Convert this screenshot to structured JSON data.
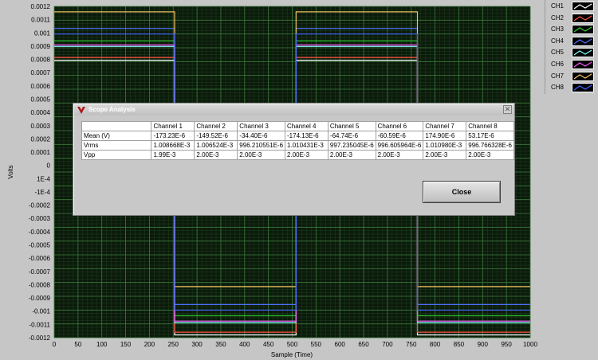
{
  "chart_data": {
    "type": "line",
    "xlabel": "Sample (Time)",
    "ylabel": "Volts",
    "xlim": [
      0,
      1000
    ],
    "ylim": [
      -0.0012,
      0.0012
    ],
    "xticks": [
      0,
      50,
      100,
      150,
      200,
      250,
      300,
      350,
      400,
      450,
      500,
      550,
      600,
      650,
      700,
      750,
      800,
      850,
      900,
      950,
      1000
    ],
    "xtick_labels": [
      "0",
      "50",
      "100",
      "150",
      "200",
      "250",
      "300",
      "350",
      "400",
      "450",
      "500",
      "550",
      "600",
      "650",
      "700",
      "750",
      "800",
      "850",
      "900",
      "950",
      "1000"
    ],
    "yticks": [
      0.0012,
      0.0011,
      0.001,
      0.0009,
      0.0008,
      0.0007,
      0.0006,
      0.0005,
      0.0004,
      0.0003,
      0.0002,
      0.0001,
      0,
      -0.0001,
      -0.0002,
      -0.0003,
      -0.0004,
      -0.0005,
      -0.0006,
      -0.0007,
      -0.0008,
      -0.0009,
      -0.001,
      -0.0011,
      -0.0012
    ],
    "ytick_labels": [
      "0.0012",
      "0.0011",
      "0.001",
      "0.0009",
      "0.0008",
      "0.0007",
      "0.0006",
      "0.0005",
      "0.0004",
      "0.0003",
      "0.0002",
      "0.0001",
      "0",
      "1E-4",
      "-1E-4",
      "-0.0002",
      "-0.0003",
      "-0.0004",
      "-0.0005",
      "-0.0006",
      "-0.0007",
      "-0.0008",
      "-0.0009",
      "-0.001",
      "-0.0011",
      "-0.0012"
    ],
    "grid": true,
    "legend_position": "top-right",
    "edges": [
      0,
      253,
      508,
      763,
      1000
    ],
    "series": [
      {
        "name": "CH1",
        "color": "#ffffff",
        "high": 0.00081,
        "low": -0.00118
      },
      {
        "name": "CH2",
        "color": "#ff5040",
        "high": 0.00083,
        "low": -0.00116
      },
      {
        "name": "CH3",
        "color": "#30d030",
        "high": 0.00095,
        "low": -0.00104
      },
      {
        "name": "CH4",
        "color": "#5070ff",
        "high": 0.00104,
        "low": -0.00096
      },
      {
        "name": "CH5",
        "color": "#80ffff",
        "high": 0.00091,
        "low": -0.00109
      },
      {
        "name": "CH6",
        "color": "#ff50ff",
        "high": 0.00092,
        "low": -0.00108
      },
      {
        "name": "CH7",
        "color": "#f0c060",
        "high": 0.00116,
        "low": -0.00083
      },
      {
        "name": "CH8",
        "color": "#4060ff",
        "high": 0.001,
        "low": -0.001
      }
    ]
  },
  "legend": {
    "items": [
      {
        "label": "CH1",
        "color": "#ffffff"
      },
      {
        "label": "CH2",
        "color": "#ff5040"
      },
      {
        "label": "CH3",
        "color": "#30d030"
      },
      {
        "label": "CH4",
        "color": "#5070ff"
      },
      {
        "label": "CH5",
        "color": "#80ffff"
      },
      {
        "label": "CH6",
        "color": "#ff50ff"
      },
      {
        "label": "CH7",
        "color": "#f0c060"
      },
      {
        "label": "CH8",
        "color": "#4060ff"
      }
    ]
  },
  "dialog": {
    "title": "Scope Analysis",
    "close_glyph": "✕",
    "icon": "labview-icon",
    "close_button_label": "Close",
    "table": {
      "columns": [
        "Channel 1",
        "Channel 2",
        "Channel 3",
        "Channel 4",
        "Channel 5",
        "Channel 6",
        "Channel 7",
        "Channel 8"
      ],
      "rows": [
        {
          "label": "Mean (V)",
          "values": [
            "-173.23E-6",
            "-149.52E-6",
            "-34.40E-6",
            "-174.13E-6",
            "-64.74E-6",
            "-60.59E-6",
            "174.90E-6",
            "53.17E-6"
          ]
        },
        {
          "label": "Vrms",
          "values": [
            "1.008668E-3",
            "1.006524E-3",
            "996.210551E-6",
            "1.010431E-3",
            "997.235045E-6",
            "996.605964E-6",
            "1.010980E-3",
            "996.766328E-6"
          ]
        },
        {
          "label": "Vpp",
          "values": [
            "1.99E-3",
            "2.00E-3",
            "2.00E-3",
            "2.00E-3",
            "2.00E-3",
            "2.00E-3",
            "2.00E-3",
            "2.00E-3"
          ]
        }
      ]
    }
  }
}
